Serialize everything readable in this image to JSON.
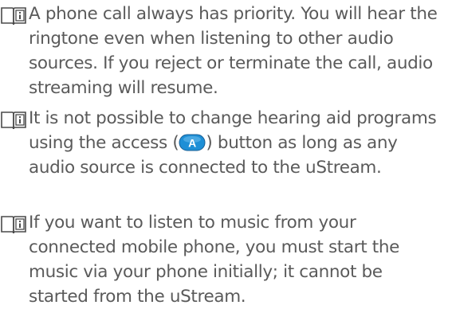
{
  "notes": [
    {
      "icon": "book-info-icon",
      "text": "A phone call always has priority. You will hear the ringtone even when listening to other audio sources. If you reject or terminate the call, audio streaming will resume."
    },
    {
      "icon": "book-info-icon",
      "text_before": "It is not possible to change hearing aid programs using the access (",
      "button_letter": "A",
      "text_after": ") button as long as any audio source is connected to the uStream."
    },
    {
      "icon": "book-info-icon",
      "text": "If you want to listen to music from your connected mobile phone, you must start the music via your phone initially; it cannot be started from the uStream."
    }
  ],
  "colors": {
    "text": "#5a5a5a",
    "access_button": "#1e8fd6",
    "icon_stroke": "#4a4a4a"
  }
}
